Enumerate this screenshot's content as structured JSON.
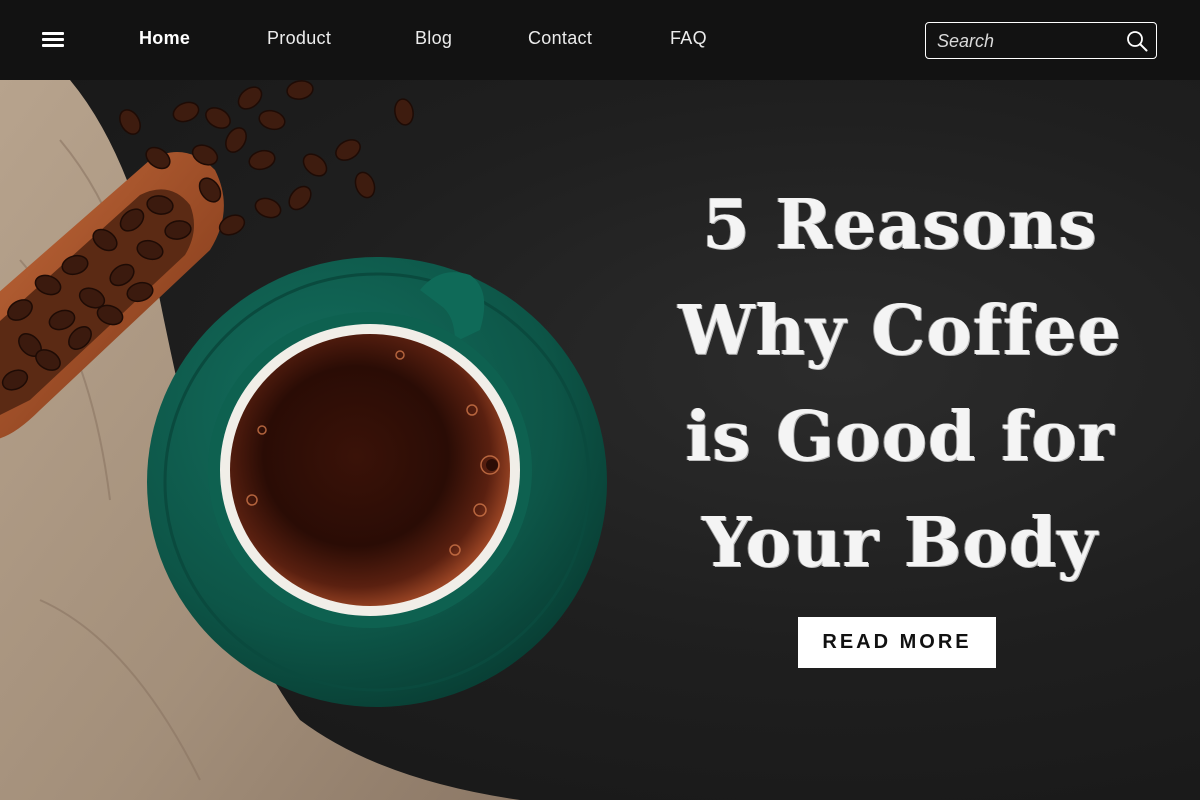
{
  "nav": {
    "menu_icon": "hamburger-menu-icon",
    "links": [
      {
        "label": "Home",
        "active": true
      },
      {
        "label": "Product",
        "active": false
      },
      {
        "label": "Blog",
        "active": false
      },
      {
        "label": "Contact",
        "active": false
      },
      {
        "label": "FAQ",
        "active": false
      }
    ],
    "search": {
      "placeholder": "Search",
      "value": "",
      "icon": "search-icon"
    }
  },
  "hero": {
    "headline_lines": [
      "5 Reasons",
      "Why Coffee",
      "is Good for",
      "Your Body"
    ],
    "cta_label": "READ MORE",
    "image_subject": "coffee-cup-with-beans"
  },
  "colors": {
    "nav_bg": "#121212",
    "hero_bg": "#1f1f1f",
    "cup": "#0f5c4f",
    "coffee": "#4a1a0f",
    "crema": "#b8542e",
    "cloth": "#b9a58f",
    "scoop": "#9a4a25"
  }
}
